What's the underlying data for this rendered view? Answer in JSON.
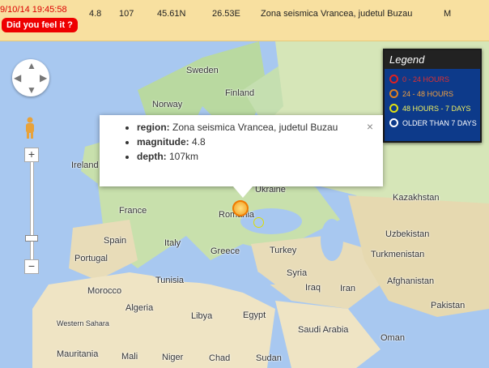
{
  "row": {
    "datetime": "9/10/14 19:45:58",
    "magnitude": "4.8",
    "depth": "107",
    "lat": "45.61N",
    "lon": "26.53E",
    "region": "Zona seismica Vrancea, judetul Buzau",
    "type": "M",
    "feel_button": "Did you feel it ?"
  },
  "legend": {
    "title": "Legend",
    "items": [
      {
        "label": "0 - 24 HOURS",
        "color": "#e02020",
        "text_color": "#e03030"
      },
      {
        "label": "24 - 48 HOURS",
        "color": "#e08020",
        "text_color": "#f0a040"
      },
      {
        "label": "48 HOURS - 7 DAYS",
        "color": "#e0e010",
        "text_color": "#f0f060"
      },
      {
        "label": "OLDER THAN 7 DAYS",
        "color": "#ffffff",
        "text_color": "#ffffff"
      }
    ]
  },
  "popup": {
    "region_key": "region:",
    "region_val": "Zona seismica Vrancea, judetul Buzau",
    "magnitude_key": "magnitude:",
    "magnitude_val": "4.8",
    "depth_key": "depth:",
    "depth_val": "107km",
    "close": "×"
  },
  "map_labels": {
    "sweden": "Sweden",
    "finland": "Finland",
    "norway": "Norway",
    "ireland": "Ireland",
    "ukraine": "Ukraine",
    "romania": "Romania",
    "kazakhstan": "Kazakhstan",
    "france": "France",
    "spain": "Spain",
    "portugal": "Portugal",
    "italy": "Italy",
    "greece": "Greece",
    "turkey": "Turkey",
    "turkmenistan": "Turkmenistan",
    "uzbekistan": "Uzbekistan",
    "afghanistan": "Afghanistan",
    "iraq": "Iraq",
    "iran": "Iran",
    "syria": "Syria",
    "morocco": "Morocco",
    "algeria": "Algeria",
    "tunisia": "Tunisia",
    "libya": "Libya",
    "egypt": "Egypt",
    "saudi": "Saudi Arabia",
    "pakistan": "Pakistan",
    "mauritania": "Mauritania",
    "mali": "Mali",
    "niger": "Niger",
    "chad": "Chad",
    "sudan": "Sudan",
    "oman": "Oman",
    "western_sahara": "Western Sahara"
  },
  "zoom": {
    "in": "+",
    "out": "−"
  }
}
